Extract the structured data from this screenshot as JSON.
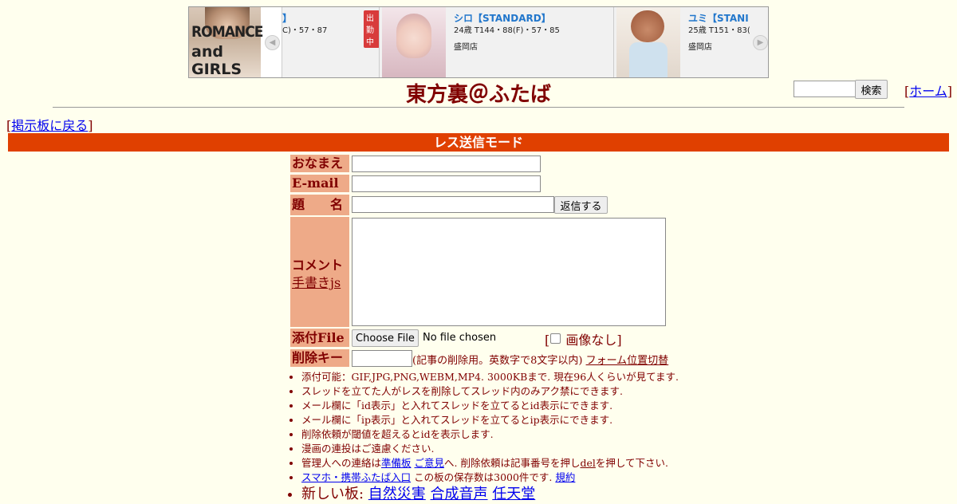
{
  "ad": {
    "logo_line1": "ROMANCE",
    "logo_line2": "and GIRLS",
    "left_arrow": "◀",
    "right_arrow": "▶",
    "cards": [
      {
        "name": "】",
        "spec": "C)・57・87",
        "shop": "",
        "badge": "出勤中"
      },
      {
        "name": "シロ【STANDARD】",
        "spec": "24歳 T144・88(F)・57・85",
        "shop": "盛岡店"
      },
      {
        "name": "ユミ【STANI",
        "spec": "25歳 T151・83(",
        "shop": "盛岡店"
      }
    ]
  },
  "header": {
    "title": "東方裏＠ふたば",
    "search_button": "検索",
    "home_link": "ホーム",
    "back_link": "掲示板に戻る"
  },
  "mode_bar": "レス送信モード",
  "form": {
    "name_label": "おなまえ",
    "email_label": "E-mail",
    "subject_label": "題　　名",
    "submit_button": "返信する",
    "comment_label": "コメント",
    "tegaki_link": "手書きjs",
    "file_label": "添付File",
    "choose_file_button": "Choose File",
    "no_file_text": "No file chosen",
    "noimage_label": "画像なし",
    "delkey_label": "削除キー",
    "delkey_note": "(記事の削除用。英数字で8文字以内)",
    "form_position_link": "フォーム位置切替"
  },
  "rules": {
    "r1": "添付可能：GIF,JPG,PNG,WEBM,MP4. 3000KBまで. 現在96人くらいが見てます.",
    "r2": "スレッドを立てた人がレスを削除してスレッド内のみアク禁にできます.",
    "r3": "メール欄に「id表示」と入れてスレッドを立てるとid表示にできます.",
    "r4": "メール欄に「ip表示」と入れてスレッドを立てるとip表示にできます.",
    "r5": "削除依頼が閾値を超えるとidを表示します.",
    "r6": "漫画の連投はご遠慮ください.",
    "r7_pre": "管理人への連絡は",
    "r7_link1": "準備板",
    "r7_link2": "ご意見",
    "r7_mid": "へ. 削除依頼は記事番号を押し",
    "r7_del": "del",
    "r7_post": "を押して下さい.",
    "r8_link": "スマホ・携帯ふたば入口",
    "r8_mid": " この板の保存数は3000件です. ",
    "r8_kiyaku": "規約",
    "r9_pre": "新しい板: ",
    "r9_boards": [
      "自然災害",
      "合成音声",
      "任天堂"
    ]
  }
}
